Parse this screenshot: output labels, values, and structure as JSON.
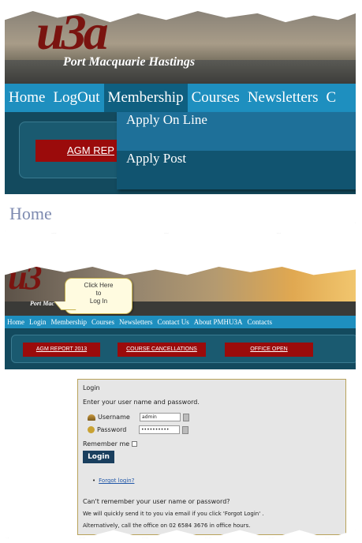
{
  "panel1": {
    "logo_text": "u3a",
    "site_subtitle": "Port Macquarie Hastings",
    "nav": [
      "Home",
      "LogOut",
      "Membership",
      "Courses",
      "Newsletters",
      "C"
    ],
    "dropdown": [
      "Apply On Line",
      "Apply Post"
    ],
    "agm_button": "AGM REP",
    "page_heading": "Home"
  },
  "panel2": {
    "logo_text": "u3",
    "site_subtitle": "Port Mac",
    "callout": [
      "Click Here",
      "to",
      "Log In"
    ],
    "nav": [
      "Home",
      "Login",
      "Membership",
      "Courses",
      "Newsletters",
      "Contact Us",
      "About PMHU3A",
      "Contacts"
    ],
    "buttons": [
      "AGM REPORT 2013",
      "COURSE CANCELLATIONS",
      "OFFICE OPEN"
    ],
    "login": {
      "title": "Login",
      "instructions": "Enter your user name and password.",
      "username_label": "Username",
      "username_value": "admin",
      "password_label": "Password",
      "password_value": "••••••••••",
      "remember_label": "Remember me",
      "submit": "Login",
      "forgot": "Forgot login?",
      "cant_remember": "Can't remember your user name or password?",
      "send_info": "We will quickly send it to you via email if you click 'Forgot Login' .",
      "alt_info": "Alternatively, call the office on 02 6584 3676 in office hours."
    }
  },
  "colors": {
    "nav": "#1e8fbf",
    "strip": "#134a5e",
    "red_button": "#9b0b0b",
    "login_button": "#1a3f5e"
  }
}
